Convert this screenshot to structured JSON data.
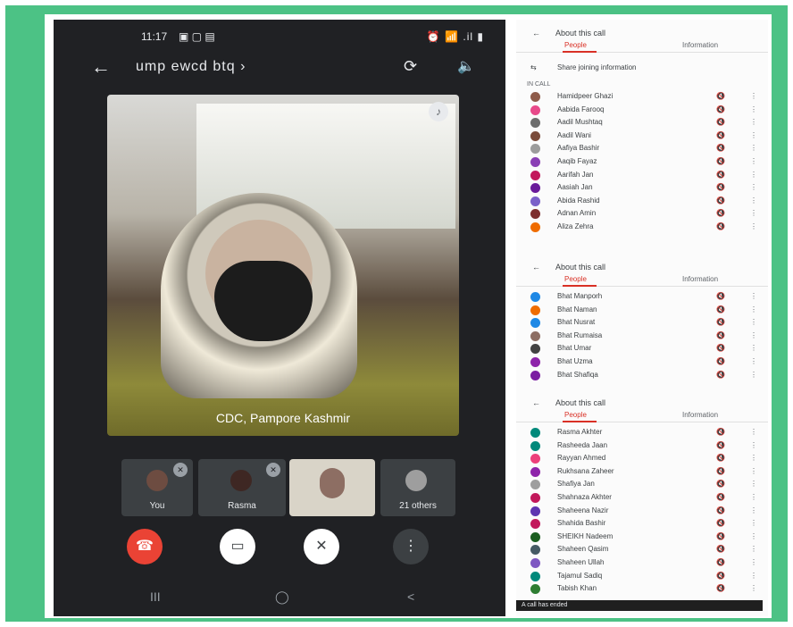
{
  "phone": {
    "status_time": "11:17",
    "status_icons": "▣ ▢ ▤",
    "status_right": "⏰ 📶 .il ▮",
    "meeting_code": "ump ewcd btq",
    "main_label": "CDC, Pampore Kashmir",
    "thumbs": [
      {
        "label": "You"
      },
      {
        "label": "Rasma"
      },
      {
        "label": ""
      },
      {
        "label": "21 others"
      }
    ],
    "nav": {
      "recent": "III",
      "home": "◯",
      "back": "<"
    }
  },
  "panel": {
    "section1": {
      "title": "About this call",
      "tab_people": "People",
      "tab_info": "Information",
      "share_label": "Share joining information",
      "list_label": "IN CALL",
      "people": [
        {
          "name": "Hamidpeer Ghazi",
          "color": "#8e5b4a"
        },
        {
          "name": "Aabida Farooq",
          "color": "#e84a8a"
        },
        {
          "name": "Aadil Mushtaq",
          "color": "#6d6d6d"
        },
        {
          "name": "Aadil Wani",
          "color": "#7a4c3b"
        },
        {
          "name": "Aafiya Bashir",
          "color": "#9c9c9c"
        },
        {
          "name": "Aaqib Fayaz",
          "color": "#8a3fb5"
        },
        {
          "name": "Aarifah Jan",
          "color": "#c2185b"
        },
        {
          "name": "Aasiah Jan",
          "color": "#6a1b9a"
        },
        {
          "name": "Abida Rashid",
          "color": "#7b61c9"
        },
        {
          "name": "Adnan Amin",
          "color": "#7d2f2f"
        },
        {
          "name": "Aliza Zehra",
          "color": "#ef6c00"
        }
      ]
    },
    "section2": {
      "title": "About this call",
      "tab_people": "People",
      "tab_info": "Information",
      "people": [
        {
          "name": "Bhat Manporh",
          "color": "#1e88e5"
        },
        {
          "name": "Bhat Naman",
          "color": "#ef6c00"
        },
        {
          "name": "Bhat Nusrat",
          "color": "#1e88e5"
        },
        {
          "name": "Bhat Rumaisa",
          "color": "#8d6e63"
        },
        {
          "name": "Bhat Umar",
          "color": "#424242"
        },
        {
          "name": "Bhat Uzma",
          "color": "#8e24aa"
        },
        {
          "name": "Bhat Shafiqa",
          "color": "#7b1fa2"
        }
      ]
    },
    "section3": {
      "title": "About this call",
      "tab_people": "People",
      "tab_info": "Information",
      "people": [
        {
          "name": "Rasma Akhter",
          "color": "#00897b"
        },
        {
          "name": "Rasheeda Jaan",
          "color": "#00897b"
        },
        {
          "name": "Rayyan Ahmed",
          "color": "#ec407a"
        },
        {
          "name": "Rukhsana Zaheer",
          "color": "#8e24aa"
        },
        {
          "name": "Shafiya Jan",
          "color": "#9e9e9e"
        },
        {
          "name": "Shahnaza Akhter",
          "color": "#c2185b"
        },
        {
          "name": "Shaheena Nazir",
          "color": "#5e35b1"
        },
        {
          "name": "Shahida Bashir",
          "color": "#c2185b"
        },
        {
          "name": "SHEIKH Nadeem",
          "color": "#1b5e20"
        },
        {
          "name": "Shaheen Qasim",
          "color": "#455a64"
        },
        {
          "name": "Shaheen Ullah",
          "color": "#7e57c2"
        },
        {
          "name": "Tajamul Sadiq",
          "color": "#00897b"
        },
        {
          "name": "Tabish Khan",
          "color": "#2e7d32"
        }
      ]
    },
    "mute_icon": "🔇",
    "more_icon": "⋮",
    "toast": "A call has ended"
  }
}
